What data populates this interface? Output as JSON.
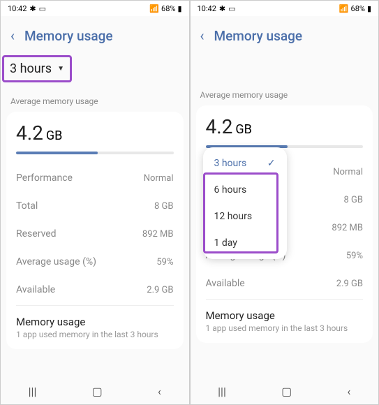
{
  "status": {
    "time": "10:42",
    "battery": "68%"
  },
  "header": {
    "title": "Memory usage"
  },
  "period": {
    "selected": "3 hours",
    "options": [
      "6 hours",
      "12 hours",
      "1 day"
    ]
  },
  "avg_label": "Average memory usage",
  "avg_value": "4.2",
  "avg_unit": "GB",
  "progress_pct": 52,
  "rows": [
    {
      "label": "Performance",
      "value": "Normal"
    },
    {
      "label": "Total",
      "value": "8 GB"
    },
    {
      "label": "Reserved",
      "value": "892 MB"
    },
    {
      "label": "Average usage (%)",
      "value": "59%"
    },
    {
      "label": "Available",
      "value": "2.9 GB"
    }
  ],
  "memory_usage": {
    "title": "Memory usage",
    "subtitle": "1 app used memory in the last 3 hours"
  }
}
